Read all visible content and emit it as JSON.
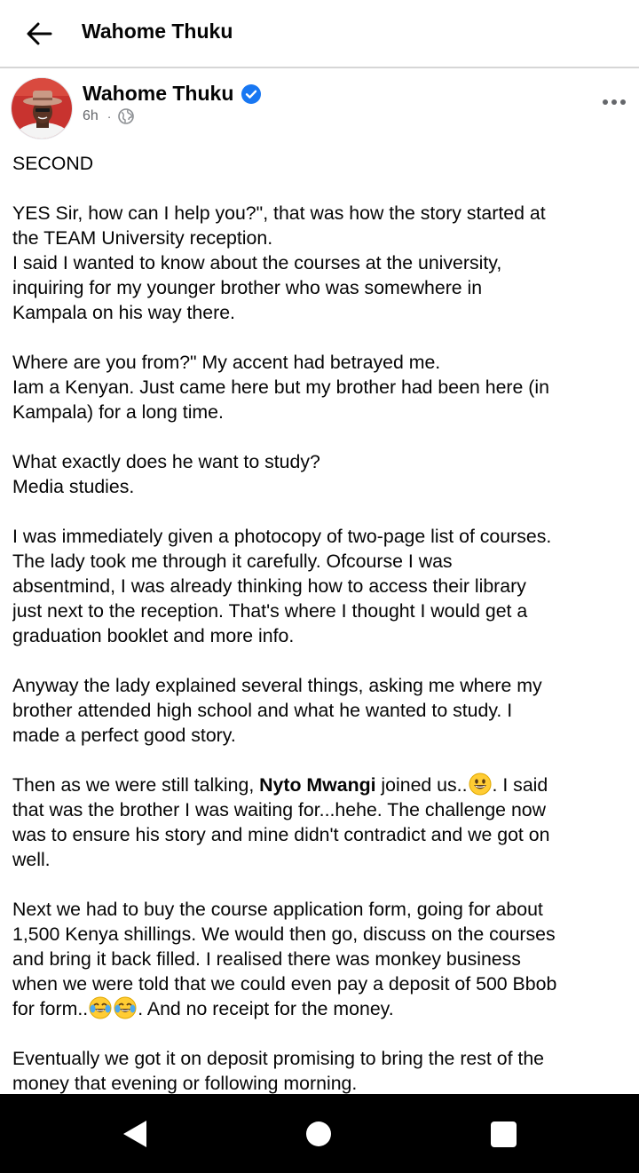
{
  "appbar": {
    "title": "Wahome Thuku"
  },
  "post": {
    "author": "Wahome Thuku",
    "time": "6h",
    "meta_separator": "·",
    "accent_color": "#1877f2",
    "paragraphs": [
      {
        "lines": [
          "SECOND"
        ]
      },
      {
        "lines": [
          "YES Sir, how can I help you?\", that was how the story started at",
          "the TEAM University reception.",
          "I said I wanted to know about the courses at the university,",
          "inquiring for my younger brother who was somewhere in",
          "Kampala on his way there."
        ]
      },
      {
        "lines": [
          "Where are you from?\" My accent had betrayed me.",
          "Iam a Kenyan. Just came here but my brother had been here (in",
          "Kampala) for a long time."
        ]
      },
      {
        "lines": [
          "What exactly does he want to study?",
          "Media studies."
        ]
      },
      {
        "lines": [
          "I was immediately given a photocopy of two-page list of courses.",
          "The lady took me through it carefully.  Ofcourse I was",
          "absentmind, I was already thinking how to access their library",
          "just next to the reception.  That's where I thought I would get a",
          "graduation booklet and more info."
        ]
      },
      {
        "lines": [
          "Anyway the lady explained several things, asking me where my",
          "brother attended high school and what he wanted to study. I",
          "made a perfect good story."
        ]
      },
      {
        "first_line": {
          "before": "Then as we were still talking,  ",
          "mention": "Nyto Mwangi",
          "after_mention": " joined us..",
          "after_emoji": ". I said"
        },
        "lines": [
          "that was the brother I was waiting for...hehe. The challenge now",
          "was to ensure his story and mine didn't contradict and we got on",
          "well."
        ]
      },
      {
        "lines": [
          "Next we had to buy the course application form, going for about",
          "1,500 Kenya shillings. We would then go, discuss on the courses",
          "and bring it back filled. I realised there was monkey business",
          "when we were told that we could even pay a deposit of 500 Bbob"
        ],
        "last_line": {
          "before": "for form..",
          "after": ". And no receipt for the money."
        }
      },
      {
        "lines": [
          "Eventually we got it on deposit promising to bring the rest of the",
          "money that evening or following morning."
        ]
      }
    ]
  },
  "icons": {
    "back": "arrow-left-icon",
    "verified": "verified-badge-icon",
    "privacy": "globe-icon",
    "more": "more-horizontal-icon",
    "emoji_grin": "grinning-face-emoji",
    "emoji_joy": "face-with-tears-of-joy-emoji"
  }
}
